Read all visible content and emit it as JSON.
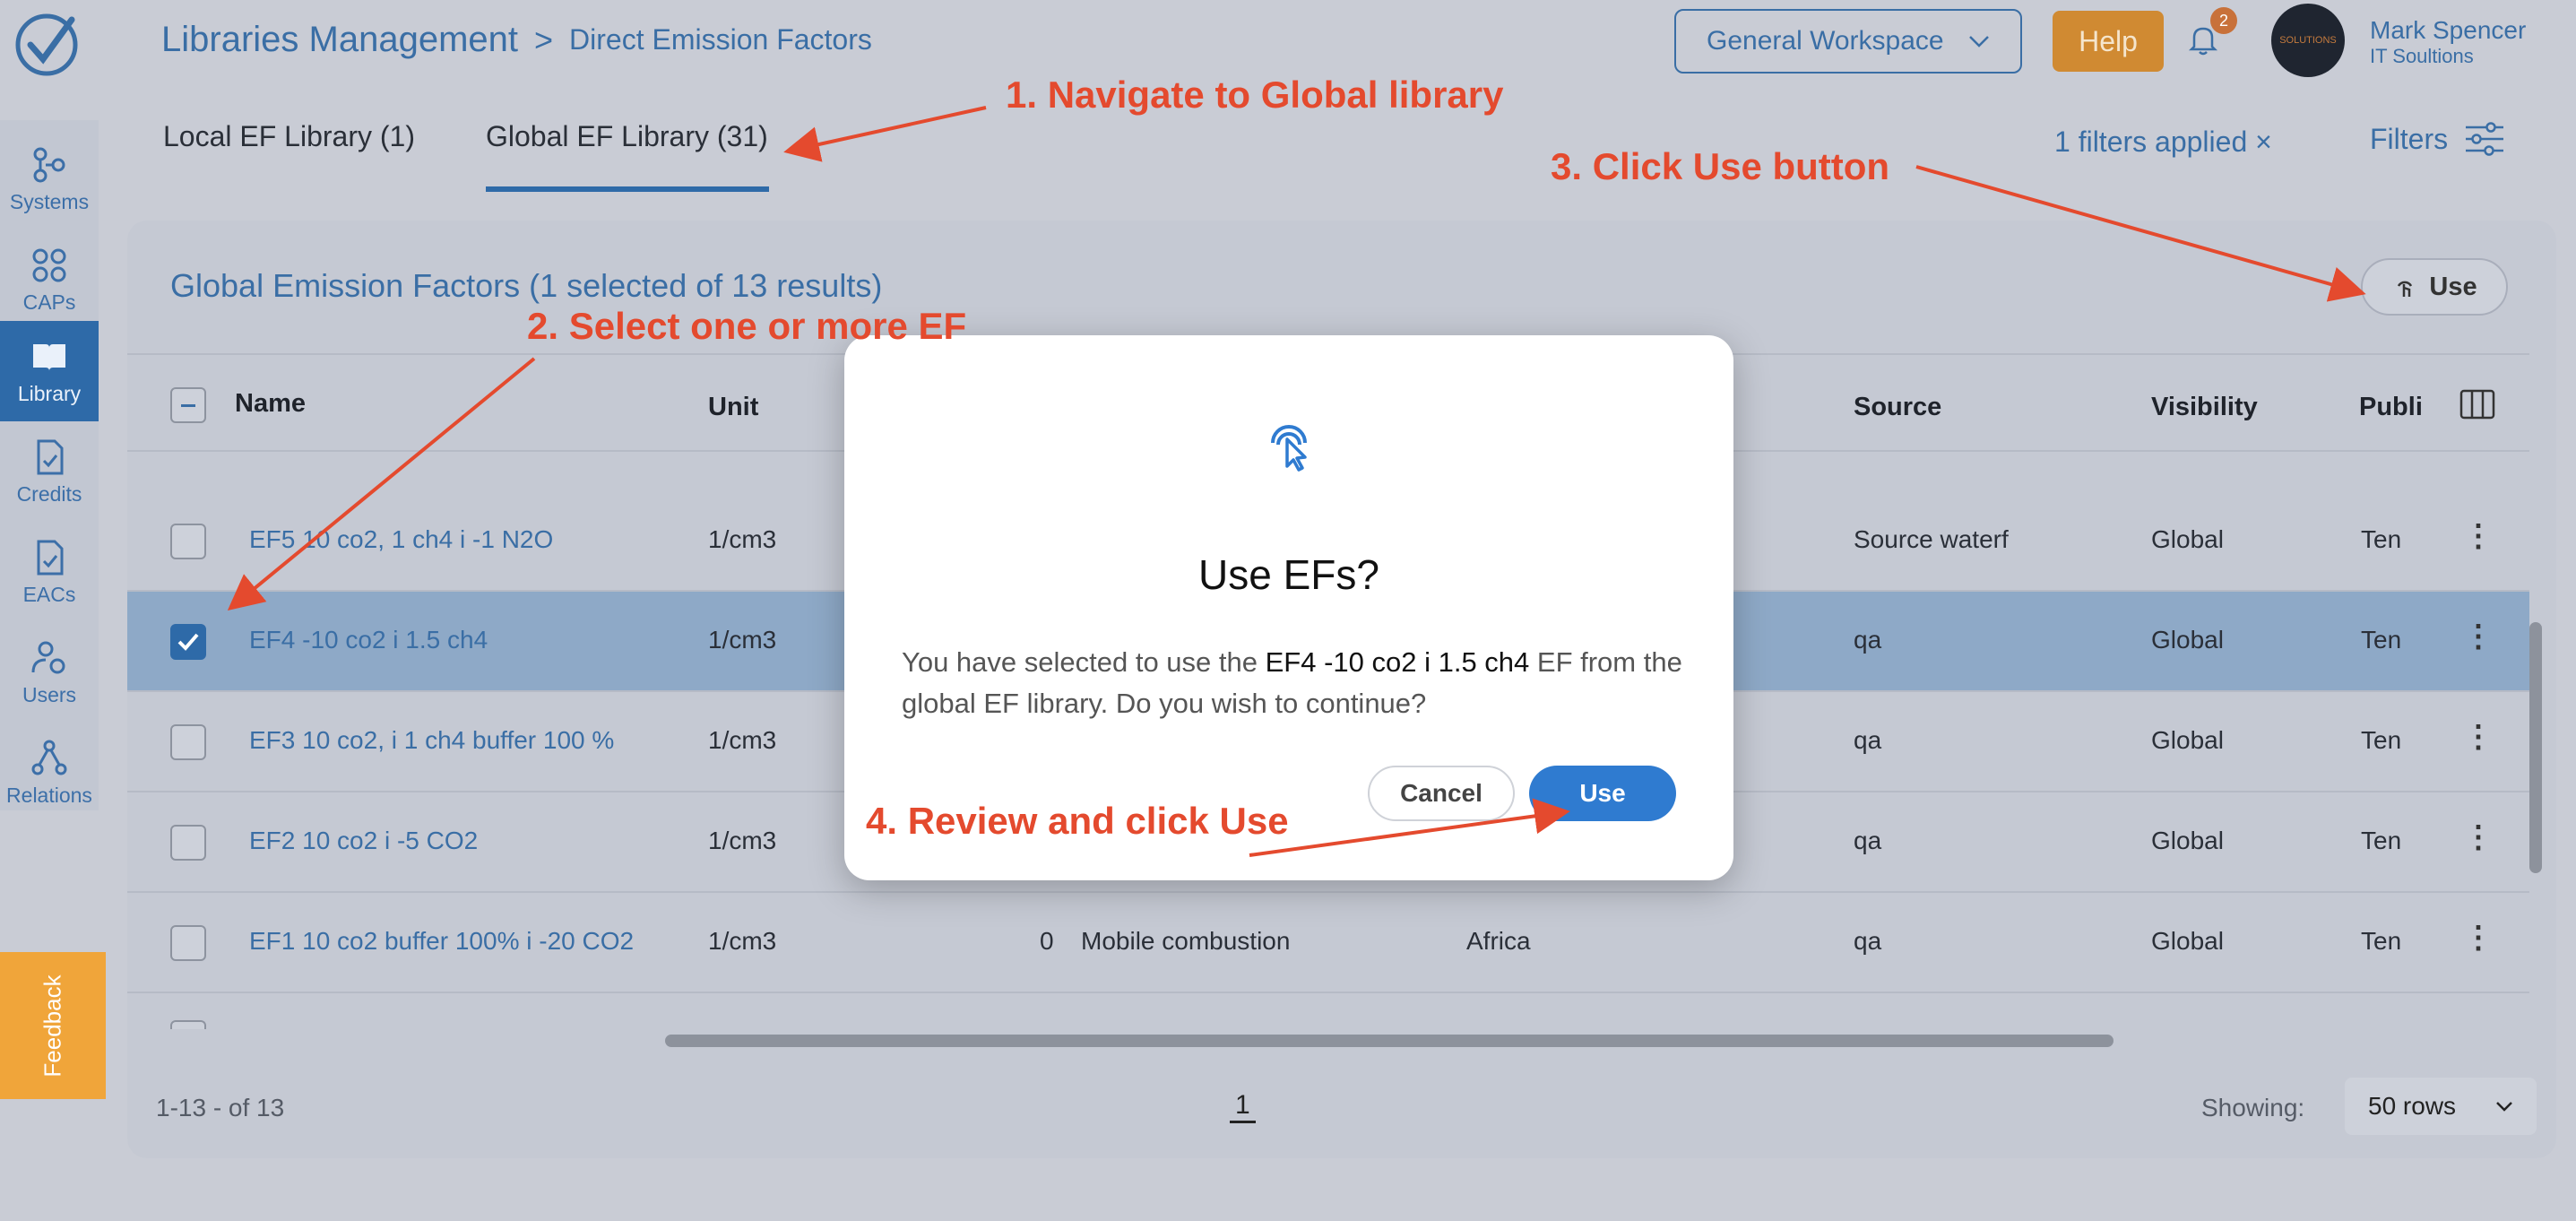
{
  "header": {
    "breadcrumb_root": "Libraries Management",
    "breadcrumb_sep": ">",
    "breadcrumb_current": "Direct Emission Factors",
    "workspace": "General Workspace",
    "help": "Help",
    "notifications": "2",
    "user_name": "Mark Spencer",
    "user_org": "IT Soultions",
    "avatar_text": "SOLUTIONS"
  },
  "sidebar": {
    "items": [
      {
        "label": "Systems",
        "icon": "systems-icon"
      },
      {
        "label": "CAPs",
        "icon": "grid-icon"
      },
      {
        "label": "Library",
        "icon": "book-icon",
        "active": true
      },
      {
        "label": "Credits",
        "icon": "document-check-icon"
      },
      {
        "label": "EACs",
        "icon": "document-check-icon"
      },
      {
        "label": "Users",
        "icon": "user-gear-icon"
      },
      {
        "label": "Relations",
        "icon": "relations-icon"
      }
    ],
    "feedback": "Feedback"
  },
  "tabs": {
    "local": "Local EF Library (1)",
    "global": "Global EF Library (31)",
    "active": "global"
  },
  "filters": {
    "applied": "1 filters applied",
    "clear": "×",
    "label": "Filters"
  },
  "panel": {
    "title": "Global Emission Factors (1 selected of 13 results)",
    "use_button": "Use"
  },
  "table": {
    "columns": {
      "name": "Name",
      "unit": "Unit",
      "source": "Source",
      "visibility": "Visibility",
      "published": "Publi"
    },
    "rows": [
      {
        "name": "EF5 10 co2, 1 ch4 i -1 N2O",
        "unit": "1/cm3",
        "value": "",
        "category": "",
        "region": "",
        "source": "Source waterf",
        "visibility": "Global",
        "published": "Ten",
        "selected": false
      },
      {
        "name": "EF4 -10 co2 i 1.5 ch4",
        "unit": "1/cm3",
        "value": "",
        "category": "",
        "region": "",
        "source": "qa",
        "visibility": "Global",
        "published": "Ten",
        "selected": true
      },
      {
        "name": "EF3 10 co2, i 1 ch4 buffer 100 %",
        "unit": "1/cm3",
        "value": "",
        "category": "",
        "region": "",
        "source": "qa",
        "visibility": "Global",
        "published": "Ten",
        "selected": false
      },
      {
        "name": "EF2 10 co2 i -5 CO2",
        "unit": "1/cm3",
        "value": "",
        "category": "",
        "region": "",
        "source": "qa",
        "visibility": "Global",
        "published": "Ten",
        "selected": false
      },
      {
        "name": "EF1 10 co2 buffer 100% i -20 CO2",
        "unit": "1/cm3",
        "value": "0",
        "category": "Mobile combustion",
        "region": "Africa",
        "source": "qa",
        "visibility": "Global",
        "published": "Ten",
        "selected": false
      }
    ]
  },
  "pagination": {
    "range": "1-13 - of 13",
    "page": "1",
    "showing_label": "Showing:",
    "rows_option": "50 rows"
  },
  "modal": {
    "title": "Use EFs?",
    "body_prefix": "You have selected to use the ",
    "body_highlight": "EF4 -10 co2 i 1.5 ch4",
    "body_suffix": " EF from the global EF library. Do you wish to continue?",
    "cancel": "Cancel",
    "confirm": "Use"
  },
  "annotations": {
    "step1": "1. Navigate to Global library",
    "step2": "2. Select one or more EF",
    "step3": "3. Click Use button",
    "step4": "4. Review and click Use",
    "color": "#e44a2e"
  },
  "colors": {
    "accent": "#2e6aa8",
    "modal_use": "#2f7bd0",
    "help": "#d08a32",
    "feedback": "#f0a53a"
  }
}
